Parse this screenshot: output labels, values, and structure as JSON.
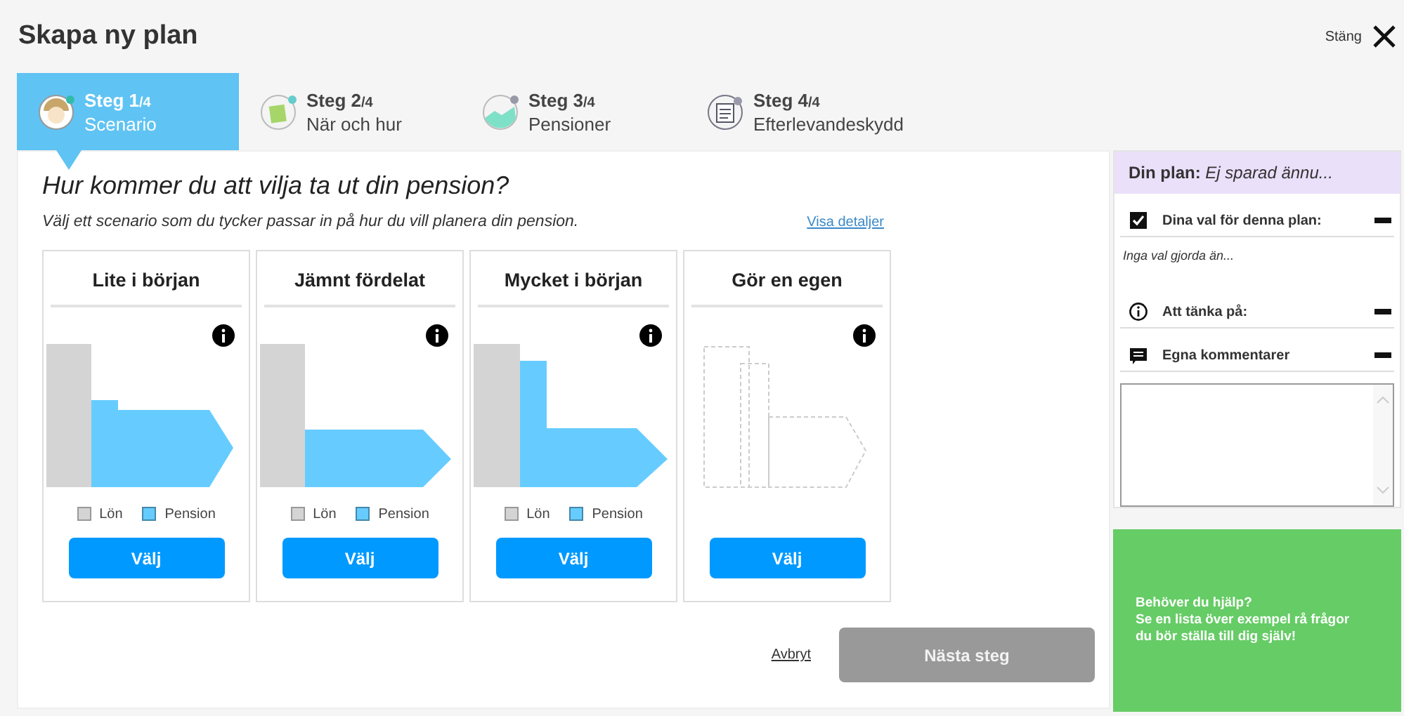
{
  "window": {
    "title": "Skapa ny plan",
    "close_label": "Stäng"
  },
  "steps": [
    {
      "step": "Steg 1",
      "total": "/4",
      "label": "Scenario",
      "selected": true,
      "kind": "face"
    },
    {
      "step": "Steg 2",
      "total": "/4",
      "label": "När och hur",
      "selected": false,
      "kind": "money"
    },
    {
      "step": "Steg 3",
      "total": "/4",
      "label": "Pensioner",
      "selected": false,
      "kind": "chart"
    },
    {
      "step": "Steg 4",
      "total": "/4",
      "label": "Efterlevandeskydd",
      "selected": false,
      "kind": "document"
    }
  ],
  "main": {
    "heading": "Hur kommer du att vilja ta ut din pension?",
    "subtitle": "Välj ett scenario som du tycker passar in på hur du vill planera din pension.",
    "details_link": "Visa detaljer",
    "scenarios": [
      {
        "title": "Lite i början",
        "kind": "low_start",
        "legend": [
          "Lön",
          "Pension"
        ],
        "button": "Välj"
      },
      {
        "title": "Jämnt fördelat",
        "kind": "even",
        "legend": [
          "Lön",
          "Pension"
        ],
        "button": "Välj"
      },
      {
        "title": "Mycket i början",
        "kind": "high_start",
        "legend": [
          "Lön",
          "Pension"
        ],
        "button": "Välj"
      },
      {
        "title": "Gör en egen",
        "kind": "custom",
        "button": "Välj"
      }
    ],
    "cancel": "Avbryt",
    "next": {
      "label": "Nästa steg",
      "disabled": true
    }
  },
  "sidebar": {
    "header": "**Din plan:** *Ej sparad ännu...*",
    "sections": [
      {
        "kind": "checkbox",
        "title": "Dina val för denna plan:",
        "expanded": true,
        "note": "Inga val gjorda än..."
      },
      {
        "kind": "info",
        "title": "Att tänka på:",
        "expanded": true
      },
      {
        "kind": "comment",
        "title": "Egna kommentarer",
        "expanded": true
      }
    ],
    "help": "Behöver du hjälp?\nSe en lista över exempel rå frågor\ndu bör ställa till dig själv!"
  }
}
